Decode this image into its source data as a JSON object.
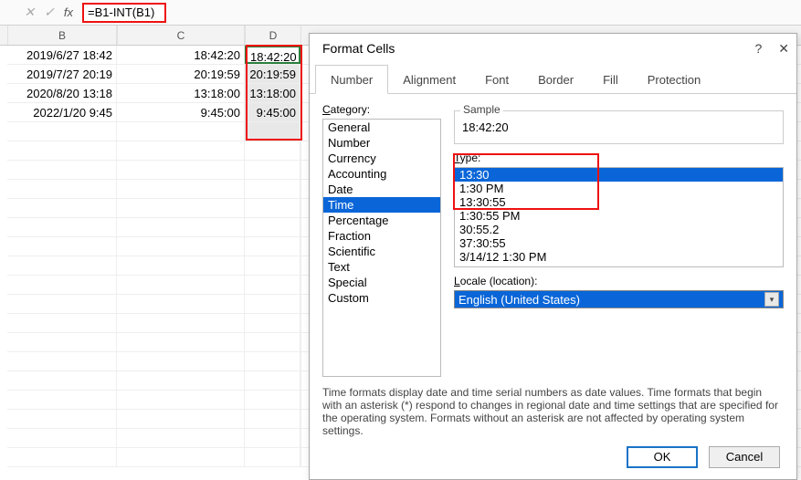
{
  "formula": "=B1-INT(B1)",
  "columns": {
    "B": "B",
    "C": "C",
    "D": "D"
  },
  "rows": [
    {
      "b": "2019/6/27 18:42",
      "c": "18:42:20",
      "d": "18:42:20"
    },
    {
      "b": "2019/7/27 20:19",
      "c": "20:19:59",
      "d": "20:19:59"
    },
    {
      "b": "2020/8/20 13:18",
      "c": "13:18:00",
      "d": "13:18:00"
    },
    {
      "b": "2022/1/20 9:45",
      "c": "9:45:00",
      "d": "9:45:00"
    }
  ],
  "dialog": {
    "title": "Format Cells",
    "tabs": [
      "Number",
      "Alignment",
      "Font",
      "Border",
      "Fill",
      "Protection"
    ],
    "category_label": "Category:",
    "categories": [
      "General",
      "Number",
      "Currency",
      "Accounting",
      "Date",
      "Time",
      "Percentage",
      "Fraction",
      "Scientific",
      "Text",
      "Special",
      "Custom"
    ],
    "selected_category": "Time",
    "sample_label": "Sample",
    "sample_value": "18:42:20",
    "type_label": "Type:",
    "types": [
      "13:30",
      "1:30 PM",
      "13:30:55",
      "1:30:55 PM",
      "30:55.2",
      "37:30:55",
      "3/14/12 1:30 PM"
    ],
    "selected_type": "13:30",
    "locale_label": "Locale (location):",
    "locale_value": "English (United States)",
    "help_text": "Time formats display date and time serial numbers as date values.  Time formats that begin with an asterisk (*) respond to changes in regional date and time settings that are specified for the operating system. Formats without an asterisk are not affected by operating system settings.",
    "ok": "OK",
    "cancel": "Cancel"
  }
}
